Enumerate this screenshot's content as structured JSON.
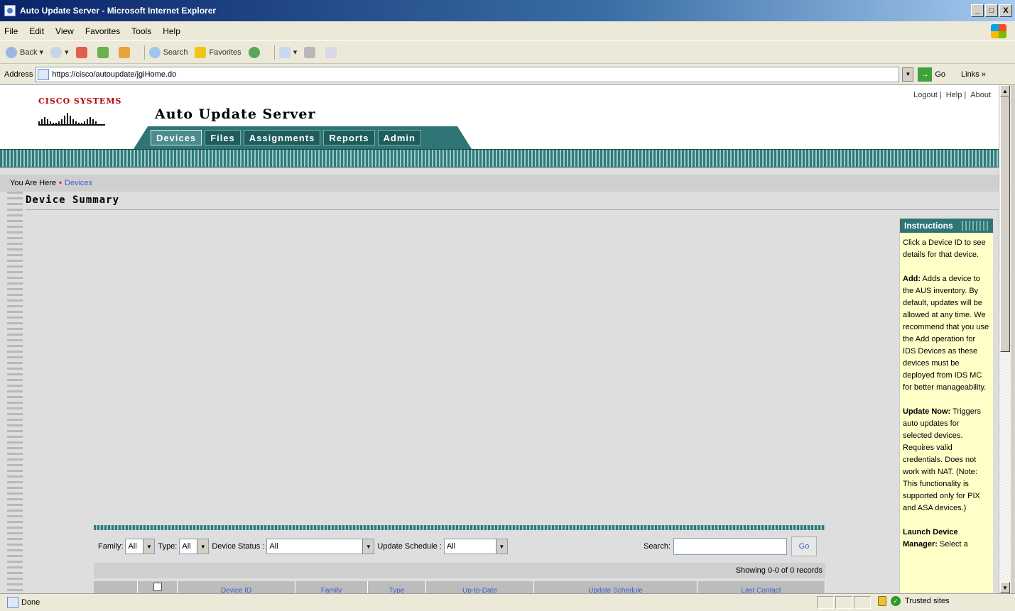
{
  "window": {
    "title": "Auto Update Server - Microsoft Internet Explorer",
    "controls": [
      "_",
      "□",
      "X"
    ]
  },
  "menu": [
    "File",
    "Edit",
    "View",
    "Favorites",
    "Tools",
    "Help"
  ],
  "toolbar": {
    "back": "Back",
    "search": "Search",
    "favorites": "Favorites"
  },
  "address": {
    "label": "Address",
    "url": "https://cisco/autoupdate/jgiHome.do",
    "go": "Go",
    "links": "Links »"
  },
  "page": {
    "brand": "CISCO SYSTEMS",
    "app_title": "Auto Update Server",
    "top_links": [
      "Logout",
      "Help",
      "About"
    ],
    "tabs": [
      "Devices",
      "Files",
      "Assignments",
      "Reports",
      "Admin"
    ],
    "active_tab": "Devices",
    "breadcrumb_prefix": "You Are Here",
    "breadcrumb_current": "Devices",
    "heading": "Device Summary"
  },
  "instructions": {
    "title": "Instructions",
    "intro": "Click a Device ID to see details for that device.",
    "add_title": "Add:",
    "add_text": "Adds a device to the AUS inventory. By default, updates will be allowed at any time. We recommend that you use the Add operation for IDS Devices as these devices must be deployed from IDS MC for better manageability.",
    "update_title": "Update Now:",
    "update_text": "Triggers auto updates for selected devices. Requires valid credentials. Does not work with NAT. (Note: This functionality is supported only for PIX and ASA devices.)",
    "launch_title": "Launch Device Manager:",
    "launch_text": "Select a"
  },
  "filters": {
    "family_label": "Family:",
    "family_value": "All",
    "type_label": "Type:",
    "type_value": "All",
    "status_label": "Device Status :",
    "status_value": "All",
    "schedule_label": "Update Schedule :",
    "schedule_value": "All",
    "search_label": "Search:",
    "search_value": "",
    "go_label": "Go"
  },
  "records": "Showing 0-0 of 0 records",
  "table_columns": [
    "Device ID",
    "Family",
    "Type",
    "Up-to-Date",
    "Update Schedule",
    "Last Contact"
  ],
  "status": {
    "text": "Done",
    "zone": "Trusted sites"
  }
}
